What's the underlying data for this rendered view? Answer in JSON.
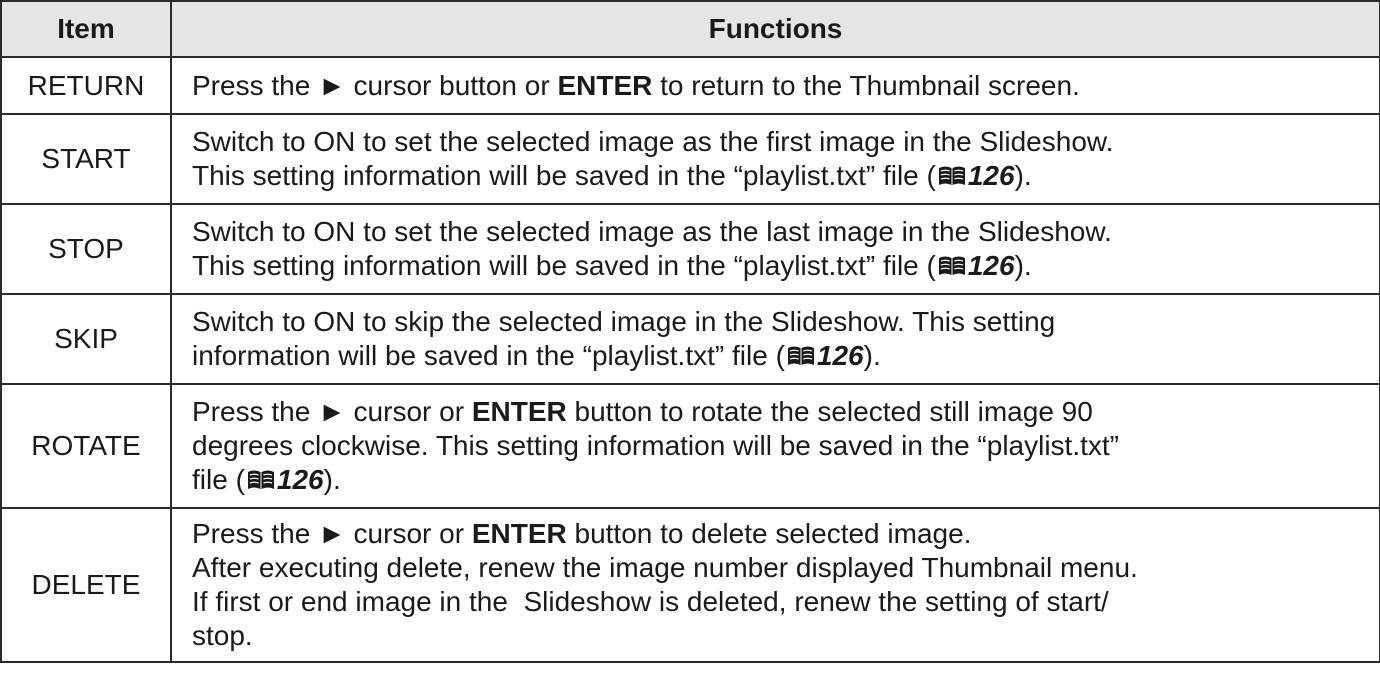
{
  "header": {
    "item": "Item",
    "functions": "Functions"
  },
  "colors": {
    "header_bg": "#e5e5e5",
    "border": "#2b2b2b",
    "icon": "#1a1a1a"
  },
  "icons": {
    "arrow": "right-triangle-icon",
    "reference": "book-icon"
  },
  "rows": {
    "return": {
      "item": "RETURN",
      "l1a": "Press the ",
      "arrow": "►",
      "l1b": " cursor button or ",
      "enter": "ENTER",
      "l1c": " to return to the Thumbnail screen."
    },
    "start": {
      "item": "START",
      "l1": "Switch to ON to set the selected image as the first image in the Slideshow.",
      "l2a": "This setting information will be saved in the “playlist.txt” file (",
      "ref": "126",
      "l2b": ")."
    },
    "stop": {
      "item": "STOP",
      "l1": "Switch to ON to set the selected image as the last image in the Slideshow.",
      "l2a": "This setting information will be saved in the “playlist.txt” file (",
      "ref": "126",
      "l2b": ")."
    },
    "skip": {
      "item": "SKIP",
      "l1": "Switch to ON to skip the selected image in the Slideshow. This setting",
      "l2a": "information will be saved in the “playlist.txt” file (",
      "ref": "126",
      "l2b": ")."
    },
    "rotate": {
      "item": "ROTATE",
      "l1a": "Press the ",
      "arrow": "►",
      "l1b": " cursor or ",
      "enter": "ENTER",
      "l1c": " button to rotate the selected still image 90",
      "l2": "degrees clockwise. This setting information will be saved in the “playlist.txt”",
      "l3a": "file (",
      "ref": "126",
      "l3b": ")."
    },
    "delete": {
      "item": "DELETE",
      "l1a": "Press the ",
      "arrow": "►",
      "l1b": " cursor or ",
      "enter": "ENTER",
      "l1c": " button to delete selected image.",
      "l2": "After executing delete, renew the image number displayed Thumbnail menu.",
      "l3": "If first or end image in the  Slideshow is deleted, renew the setting of start/",
      "l4": "stop."
    }
  }
}
